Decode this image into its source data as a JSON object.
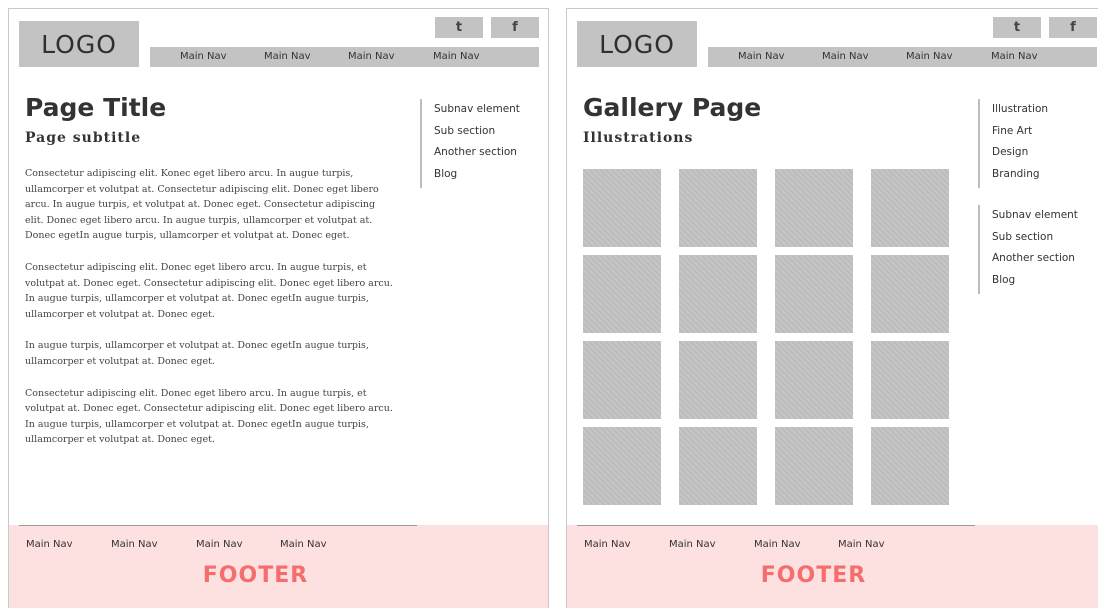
{
  "colors": {
    "placeholder_gray": "#c3c3c3",
    "footer_background": "#fde0e0",
    "footer_label": "#f56d6d",
    "subnav_rule": "#bdbdbd"
  },
  "wireframes": [
    {
      "logo": "LOGO",
      "social": [
        "t",
        "f"
      ],
      "main_nav": [
        "Main Nav",
        "Main Nav",
        "Main Nav",
        "Main Nav"
      ],
      "title": "Page Title",
      "subtitle": "Page subtitle",
      "paragraphs": [
        "Consectetur adipiscing elit. Konec eget libero arcu. In augue turpis, ullamcorper et volutpat at. Consectetur adipiscing elit. Donec eget libero arcu. In augue turpis, et volutpat at. Donec eget. Consectetur adipiscing elit. Donec eget libero arcu. In augue turpis, ullamcorper et volutpat at. Donec egetIn augue turpis, ullamcorper et volutpat at. Donec eget.",
        "Consectetur adipiscing elit. Donec eget libero arcu. In augue turpis, et volutpat at. Donec eget. Consectetur adipiscing elit. Donec eget libero arcu. In augue turpis, ullamcorper et volutpat at. Donec egetIn augue turpis, ullamcorper et volutpat at. Donec eget.",
        "In augue turpis, ullamcorper et volutpat at. Donec egetIn augue turpis, ullamcorper et volutpat at. Donec eget.",
        "Consectetur adipiscing elit. Donec eget libero arcu. In augue turpis, et volutpat at. Donec eget. Consectetur adipiscing elit. Donec eget libero arcu. In augue turpis, ullamcorper et volutpat at. Donec egetIn augue turpis, ullamcorper et volutpat at. Donec eget."
      ],
      "subnav": [
        "Subnav element",
        "Sub section",
        "Another section",
        "Blog"
      ],
      "footer_nav": [
        "Main Nav",
        "Main Nav",
        "Main Nav",
        "Main Nav"
      ],
      "footer_label": "FOOTER"
    },
    {
      "logo": "LOGO",
      "social": [
        "t",
        "f"
      ],
      "main_nav": [
        "Main Nav",
        "Main Nav",
        "Main Nav",
        "Main Nav"
      ],
      "title": "Gallery Page",
      "subtitle": "Illustrations",
      "gallery_count": 16,
      "subnav_categories": [
        "Illustration",
        "Fine Art",
        "Design",
        "Branding"
      ],
      "subnav": [
        "Subnav element",
        "Sub section",
        "Another section",
        "Blog"
      ],
      "footer_nav": [
        "Main Nav",
        "Main Nav",
        "Main Nav",
        "Main Nav"
      ],
      "footer_label": "FOOTER"
    }
  ]
}
